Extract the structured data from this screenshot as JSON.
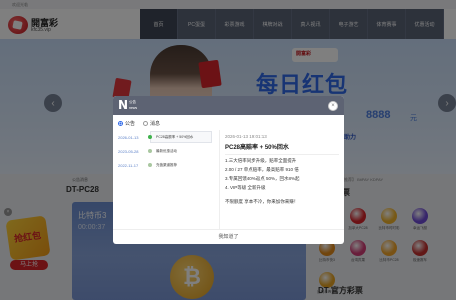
{
  "topbar": {
    "text": "欢迎光临"
  },
  "header": {
    "logo_text": "開富彩",
    "logo_sub": "kfc35.vip"
  },
  "nav": [
    "首页",
    "PC蛋蛋",
    "彩票游戏",
    "棋牌对战",
    "真人视讯",
    "电子游艺",
    "体育赛事",
    "优惠活动"
  ],
  "banner": {
    "brand": "開富彩",
    "headline": "每日红包",
    "amount": "8888",
    "yuan": "元",
    "boost": "助力"
  },
  "notice": {
    "left": "公告消息",
    "right": "【充值渠道推荐】 BitPAY KDPAY"
  },
  "left_panel": {
    "title": "DT-PC28",
    "card_title": "比特币3",
    "card_time": "00:00:37"
  },
  "right_panel": {
    "title": "热门彩票",
    "lotteries": [
      {
        "name": "比特币1分彩",
        "color": "#e8a21f"
      },
      {
        "name": "加拿大PC28",
        "color": "#d8242b"
      },
      {
        "name": "比特币时时彩",
        "color": "#f0b32c"
      },
      {
        "name": "幸运飞艇",
        "color": "#6e4ad6"
      },
      {
        "name": "比特币快3",
        "color": "#e28a1a"
      },
      {
        "name": "台湾宾果",
        "color": "#d23c76"
      },
      {
        "name": "比特币PC28",
        "color": "#f2a52a"
      },
      {
        "name": "极速赛车",
        "color": "#c4312f"
      },
      {
        "name": "比特币11选5",
        "color": "#e6a322"
      }
    ],
    "bottom_title": "DT-官方彩票"
  },
  "float_ad": {
    "close": "×",
    "bag_text": "抢红包",
    "cta": "马上抢"
  },
  "modal": {
    "badge_letter": "N",
    "badge_line1": "公告",
    "badge_line2": "news",
    "close": "×",
    "tabs": [
      {
        "label": "公告",
        "selected": true
      },
      {
        "label": "消息",
        "selected": false
      }
    ],
    "messages": [
      {
        "date": "2026-01-13",
        "title": "PC28高额率 + 50%回水",
        "active": true
      },
      {
        "date": "2023-05-28",
        "title": "最新优惠活动",
        "active": false
      },
      {
        "date": "2022-11-17",
        "title": "充值渠道推荐",
        "active": false
      }
    ],
    "detail": {
      "date": "2026-01-13 19:01:13",
      "title": "PC28高赔率 + 50%回水",
      "lines": [
        "1.三大倍率同步升级，赔率全面提升",
        "2.00 / 27 单点赔率，最高赔率 910 倍",
        "3.专属回馈40%返点 50%，回水8%起",
        "4. VIP等级 全新升级",
        "",
        "不限额度 享本不冷，你来加你来赚！"
      ]
    },
    "ok_label": "我知道了"
  }
}
